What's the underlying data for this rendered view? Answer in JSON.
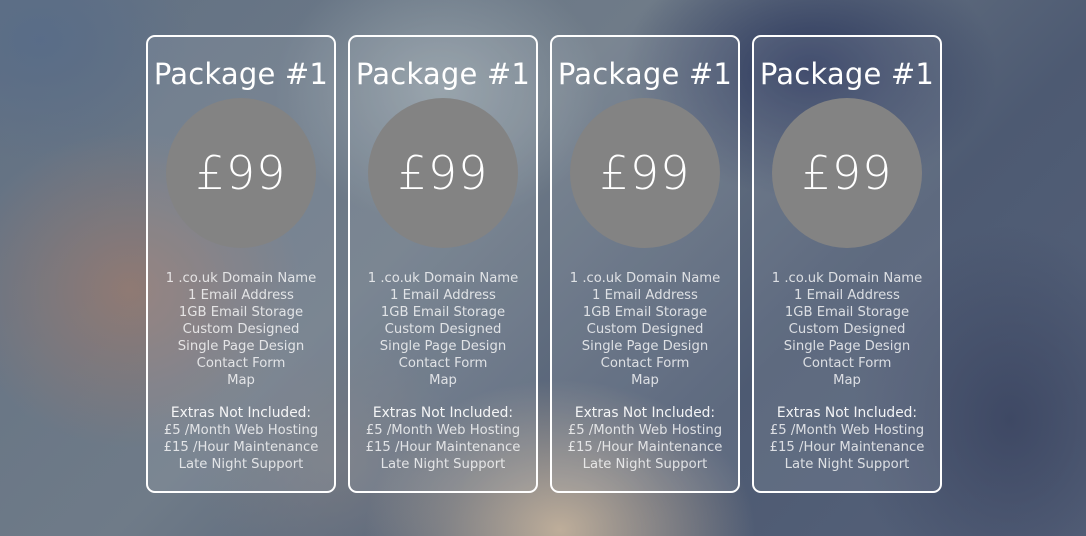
{
  "packages": [
    {
      "title": "Package #1",
      "price": "£99",
      "features": [
        "1 .co.uk Domain Name",
        "1 Email Address",
        "1GB Email Storage",
        "Custom Designed",
        "Single Page Design",
        "Contact Form",
        "Map"
      ],
      "extras_heading": "Extras Not Included:",
      "extras": [
        "£5 /Month Web Hosting",
        "£15 /Hour Maintenance",
        "Late Night Support"
      ]
    },
    {
      "title": "Package #1",
      "price": "£99",
      "features": [
        "1 .co.uk Domain Name",
        "1 Email Address",
        "1GB Email Storage",
        "Custom Designed",
        "Single Page Design",
        "Contact Form",
        "Map"
      ],
      "extras_heading": "Extras Not Included:",
      "extras": [
        "£5 /Month Web Hosting",
        "£15 /Hour Maintenance",
        "Late Night Support"
      ]
    },
    {
      "title": "Package #1",
      "price": "£99",
      "features": [
        "1 .co.uk Domain Name",
        "1 Email Address",
        "1GB Email Storage",
        "Custom Designed",
        "Single Page Design",
        "Contact Form",
        "Map"
      ],
      "extras_heading": "Extras Not Included:",
      "extras": [
        "£5 /Month Web Hosting",
        "£15 /Hour Maintenance",
        "Late Night Support"
      ]
    },
    {
      "title": "Package #1",
      "price": "£99",
      "features": [
        "1 .co.uk Domain Name",
        "1 Email Address",
        "1GB Email Storage",
        "Custom Designed",
        "Single Page Design",
        "Contact Form",
        "Map"
      ],
      "extras_heading": "Extras Not Included:",
      "extras": [
        "£5 /Month Web Hosting",
        "£15 /Hour Maintenance",
        "Late Night Support"
      ]
    }
  ],
  "colors": {
    "card_border": "#ffffff",
    "price_circle": "#838383",
    "text": "#ffffff"
  }
}
